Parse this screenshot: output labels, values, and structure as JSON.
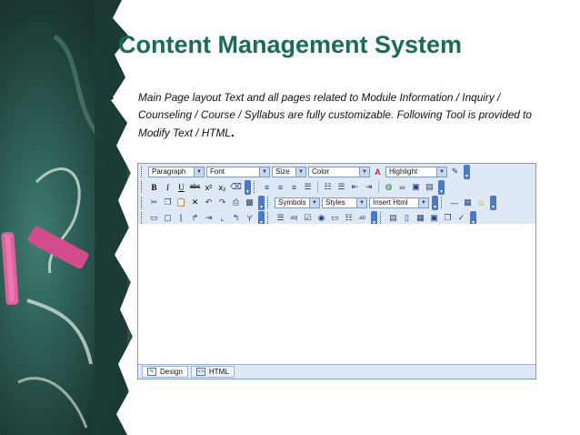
{
  "slide": {
    "title": "Content Management System",
    "bullet": "•",
    "description": "Main Page layout Text and all pages related to Module Information / Inquiry / Counseling / Course / Syllabus are fully customizable. Following Tool is provided to Modify Text / HTML",
    "description_end": "."
  },
  "colors": {
    "title": "#1a6b57",
    "toolbar_bg": "#dfe9f6",
    "border": "#7d9ec8"
  },
  "editor": {
    "row1": {
      "paragraph": "Paragraph",
      "font": "Font",
      "size": "Size",
      "color": "Color",
      "highlight": "Highlight"
    },
    "row3": {
      "symbols": "Symbols",
      "styles": "Styles",
      "insert_html": "Insert Html"
    },
    "tabs": {
      "design": "Design",
      "html": "HTML"
    }
  }
}
